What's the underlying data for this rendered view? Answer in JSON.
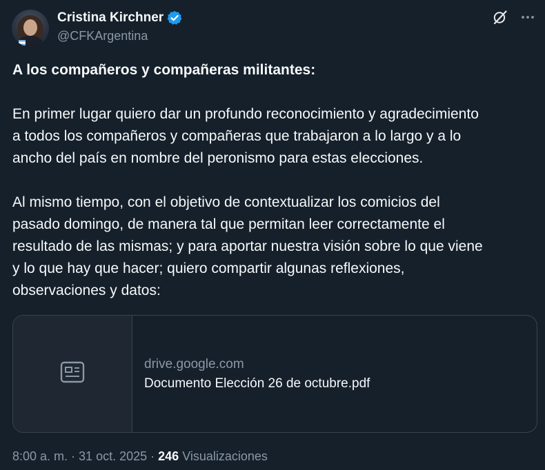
{
  "author": {
    "display_name": "Cristina Kirchner",
    "handle": "@CFKArgentina",
    "verified": true
  },
  "icons": {
    "verified": "verified-badge-icon",
    "grok": "grok-icon",
    "more": "more-options-icon",
    "document": "document-icon"
  },
  "tweet": {
    "heading": "A los compañeros y compañeras militantes:",
    "paragraphs": [
      "En primer lugar quiero dar un profundo reconocimiento y agradecimiento\na todos los compañeros y compañeras que trabajaron a lo largo y a lo\nancho del país en nombre del peronismo para estas elecciones.",
      "Al mismo tiempo, con el objetivo de contextualizar los comicios del\npasado domingo, de manera tal que permitan leer correctamente el\nresultado de las mismas; y para aportar nuestra visión sobre lo que viene\ny lo que hay que hacer; quiero compartir algunas reflexiones,\nobservaciones y datos:"
    ]
  },
  "link_card": {
    "domain": "drive.google.com",
    "title": "Documento Elección 26 de octubre.pdf"
  },
  "footer": {
    "time": "8:00 a. m.",
    "separator": "·",
    "date": "31 oct. 2025",
    "views_count": "246",
    "views_label": "Visualizaciones"
  },
  "colors": {
    "background": "#15202b",
    "text_primary": "#f7f9f9",
    "text_secondary": "#8b98a5",
    "border": "#38444d",
    "verified_blue": "#1d9bf0"
  }
}
